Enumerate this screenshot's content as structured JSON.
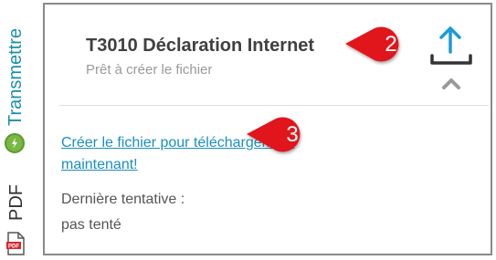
{
  "sidebar": {
    "tabs": [
      {
        "label": "Transmettre",
        "icon": "transmit-icon",
        "color": "#1a8fa8"
      },
      {
        "label": "PDF",
        "icon": "pdf-icon",
        "color": "#333333"
      }
    ]
  },
  "card": {
    "title": "T3010 Déclaration Internet",
    "subtitle": "Prêt à créer le fichier",
    "upload_icon": "upload-icon",
    "collapse_icon": "chevron-up-icon",
    "create_link": "Créer le fichier pour téléchargement maintenant!",
    "last_attempt_label": "Dernière tentative :",
    "last_attempt_value": "pas tenté"
  },
  "callouts": [
    {
      "number": "2",
      "color": "#e0161e"
    },
    {
      "number": "3",
      "color": "#e0161e"
    }
  ],
  "colors": {
    "accent": "#1a8fc0",
    "card_border": "#8a8a8a",
    "callout": "#e0161e"
  }
}
